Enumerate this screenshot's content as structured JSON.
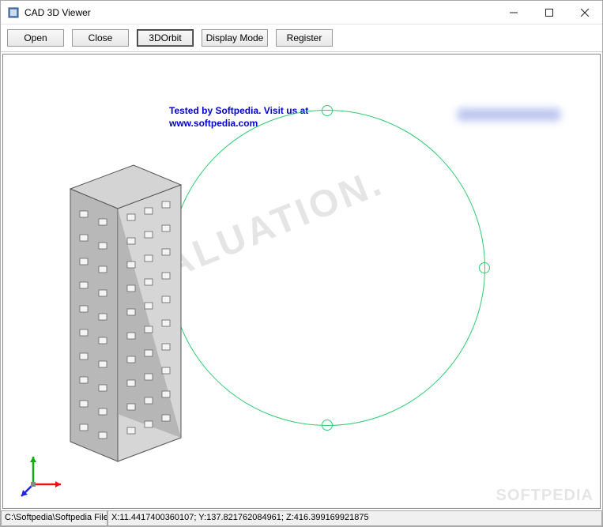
{
  "window": {
    "title": "CAD 3D Viewer"
  },
  "toolbar": {
    "open": "Open",
    "close": "Close",
    "orbit": "3DOrbit",
    "display_mode": "Display Mode",
    "register": "Register"
  },
  "viewport": {
    "watermark_line1": "Tested by Softpedia. Visit us at",
    "watermark_line2": "www.softpedia.com",
    "eval_text": "EVALUATION.",
    "softpedia": "SOFTPEDIA"
  },
  "statusbar": {
    "filepath": "C:\\Softpedia\\Softpedia Files\\Softpedi",
    "coords": "X:11.4417400360107; Y:137.821762084961; Z:416.399169921875"
  }
}
